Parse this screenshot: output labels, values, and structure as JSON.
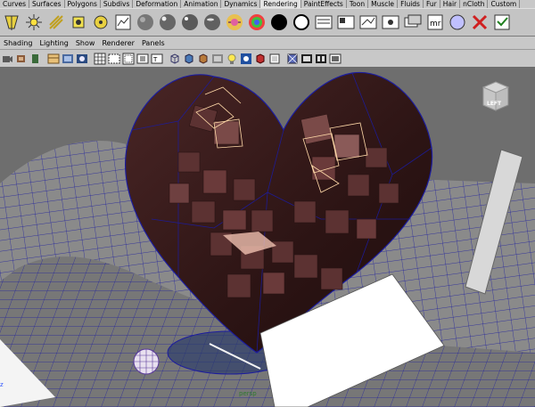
{
  "shelf": {
    "tabs": [
      {
        "label": "Curves",
        "active": false
      },
      {
        "label": "Surfaces",
        "active": false
      },
      {
        "label": "Polygons",
        "active": false
      },
      {
        "label": "Subdivs",
        "active": false
      },
      {
        "label": "Deformation",
        "active": false
      },
      {
        "label": "Animation",
        "active": false
      },
      {
        "label": "Dynamics",
        "active": false
      },
      {
        "label": "Rendering",
        "active": true
      },
      {
        "label": "PaintEffects",
        "active": false
      },
      {
        "label": "Toon",
        "active": false
      },
      {
        "label": "Muscle",
        "active": false
      },
      {
        "label": "Fluids",
        "active": false
      },
      {
        "label": "Fur",
        "active": false
      },
      {
        "label": "Hair",
        "active": false
      },
      {
        "label": "nCloth",
        "active": false
      },
      {
        "label": "Custom",
        "active": false
      }
    ],
    "icons": [
      "spot-light-icon",
      "point-light-icon",
      "directional-light-icon",
      "area-light-icon",
      "volume-light-icon",
      "hypershade-icon",
      "lambert-sphere-icon",
      "blinn-sphere-icon",
      "phong-sphere-icon",
      "anisotropic-sphere-icon",
      "shading-map-icon",
      "ramp-shader-icon",
      "black-sphere-icon",
      "surface-shader-icon",
      "render-view-icon",
      "ipr-render-icon",
      "batch-render-icon",
      "render-settings-icon",
      "render-layer-icon",
      "mental-ray-icon",
      "assign-shader-icon",
      "delete-render-icon",
      "render-globals-icon"
    ]
  },
  "panel": {
    "menus": [
      "Shading",
      "Lighting",
      "Show",
      "Renderer",
      "Panels"
    ]
  },
  "viewport": {
    "camera_label": "persp",
    "axis_label": "z",
    "viewcube_label": "LEFT"
  },
  "colors": {
    "accent_wire": "#1c1c9e",
    "selection_wire": "#ffd9a8",
    "heart": "#3a1c1c",
    "camera_label": "#2f7a2f"
  }
}
